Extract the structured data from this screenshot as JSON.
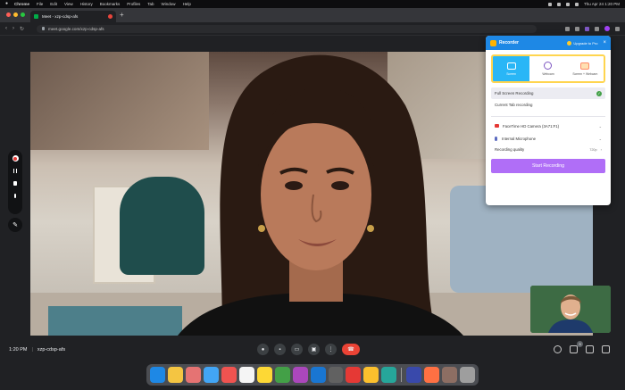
{
  "menubar": {
    "app": "Chrome",
    "items": [
      "File",
      "Edit",
      "View",
      "History",
      "Bookmarks",
      "Profiles",
      "Tab",
      "Window",
      "Help"
    ],
    "clock": "Thu Apr 24  1:20 PM"
  },
  "browser": {
    "tab_title": "Meet - xzp-cdsp-afs",
    "url": "meet.google.com/xzp-cdsp-afs"
  },
  "meet": {
    "time": "1:20 PM",
    "separator": "|",
    "meeting_code": "xzp-cdsp-afs",
    "participant_count": "3"
  },
  "recorder": {
    "title": "Recorder",
    "upgrade_label": "Upgrade to Pro",
    "modes": [
      {
        "label": "Screen",
        "active": true
      },
      {
        "label": "Webcam",
        "active": false
      },
      {
        "label": "Screen + Webcam",
        "active": false
      }
    ],
    "options": [
      {
        "label": "Full Screen Recording",
        "selected": true
      },
      {
        "label": "Current Tab recording",
        "selected": false
      }
    ],
    "camera": "FaceTime HD Camera (3A71:F1)",
    "microphone": "Internal Microphone",
    "quality_label": "Recording quality",
    "quality_value": "720p",
    "start_label": "Start Recording"
  },
  "icons": {
    "rec": "record-icon",
    "pause": "pause-icon",
    "stop": "stop-icon",
    "mic": "mic-icon",
    "pen": "pen-icon"
  }
}
